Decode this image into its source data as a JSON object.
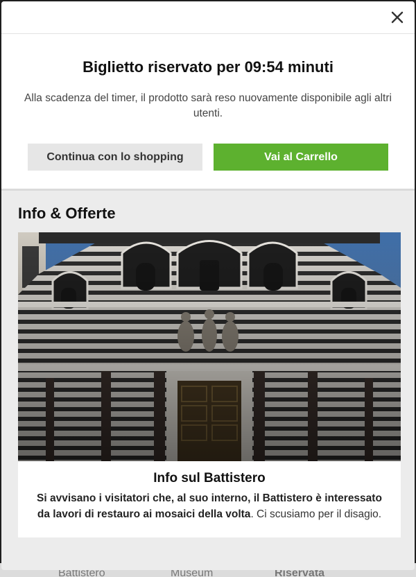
{
  "modal": {
    "close_icon": "close-icon",
    "reservation": {
      "title": "Biglietto riservato per 09:54 minuti",
      "description": "Alla scadenza del timer, il prodotto sarà reso nuovamente disponibile agli altri utenti."
    },
    "buttons": {
      "continue_shopping": "Continua con lo shopping",
      "go_to_cart": "Vai al Carrello"
    },
    "colors": {
      "accent_green": "#5db12f",
      "secondary_gray": "#e6e6e6"
    }
  },
  "info": {
    "heading": "Info & Offerte",
    "card": {
      "image": "baptistery-facade-photo",
      "title": "Info sul Battistero",
      "text_bold": "Si avvisano i visitatori che, al suo interno, il Battistero è interessato da lavori di restauro ai mosaici della volta",
      "text_rest": ". Ci scusiamo per il disagio."
    }
  },
  "background_page": {
    "items": [
      "Battistero",
      "Museum",
      "Riservata"
    ]
  }
}
